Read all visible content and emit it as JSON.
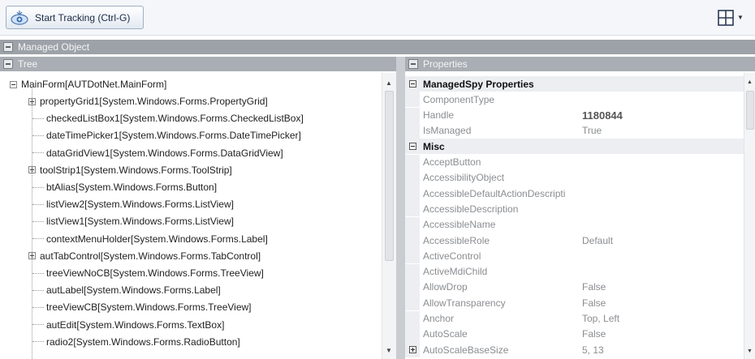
{
  "toolbar": {
    "start_tracking_label": "Start Tracking (Ctrl-G)",
    "start_icon": "eye-target-icon",
    "layout_icon": "grid-layout-icon"
  },
  "panels": {
    "managed_object_title": "Managed Object",
    "tree_title": "Tree",
    "properties_title": "Properties"
  },
  "tree": {
    "root": "MainForm[AUTDotNet.MainForm]",
    "items": [
      {
        "label": "propertyGrid1[System.Windows.Forms.PropertyGrid]",
        "expandable": true
      },
      {
        "label": "checkedListBox1[System.Windows.Forms.CheckedListBox]",
        "expandable": false
      },
      {
        "label": "dateTimePicker1[System.Windows.Forms.DateTimePicker]",
        "expandable": false
      },
      {
        "label": "dataGridView1[System.Windows.Forms.DataGridView]",
        "expandable": false
      },
      {
        "label": "toolStrip1[System.Windows.Forms.ToolStrip]",
        "expandable": true
      },
      {
        "label": "btAlias[System.Windows.Forms.Button]",
        "expandable": false
      },
      {
        "label": "listView2[System.Windows.Forms.ListView]",
        "expandable": false
      },
      {
        "label": "listView1[System.Windows.Forms.ListView]",
        "expandable": false
      },
      {
        "label": "contextMenuHolder[System.Windows.Forms.Label]",
        "expandable": false
      },
      {
        "label": "autTabControl[System.Windows.Forms.TabControl]",
        "expandable": true
      },
      {
        "label": "treeViewNoCB[System.Windows.Forms.TreeView]",
        "expandable": false
      },
      {
        "label": "autLabel[System.Windows.Forms.Label]",
        "expandable": false
      },
      {
        "label": "treeViewCB[System.Windows.Forms.TreeView]",
        "expandable": false
      },
      {
        "label": "autEdit[System.Windows.Forms.TextBox]",
        "expandable": false
      },
      {
        "label": "radio2[System.Windows.Forms.RadioButton]",
        "expandable": false
      }
    ]
  },
  "properties": {
    "cat_managedspy": "ManagedSpy Properties",
    "cat_misc": "Misc",
    "managedspy": [
      {
        "name": "ComponentType",
        "value": ""
      },
      {
        "name": "Handle",
        "value": "1180844"
      },
      {
        "name": "IsManaged",
        "value": "True"
      }
    ],
    "misc": [
      {
        "name": "AcceptButton",
        "value": ""
      },
      {
        "name": "AccessibilityObject",
        "value": ""
      },
      {
        "name": "AccessibleDefaultActionDescripti",
        "value": ""
      },
      {
        "name": "AccessibleDescription",
        "value": ""
      },
      {
        "name": "AccessibleName",
        "value": ""
      },
      {
        "name": "AccessibleRole",
        "value": "Default"
      },
      {
        "name": "ActiveControl",
        "value": ""
      },
      {
        "name": "ActiveMdiChild",
        "value": ""
      },
      {
        "name": "AllowDrop",
        "value": "False"
      },
      {
        "name": "AllowTransparency",
        "value": "False"
      },
      {
        "name": "Anchor",
        "value": "Top, Left"
      },
      {
        "name": "AutoScale",
        "value": "False"
      },
      {
        "name": "AutoScaleBaseSize",
        "value": "5, 13"
      }
    ]
  }
}
